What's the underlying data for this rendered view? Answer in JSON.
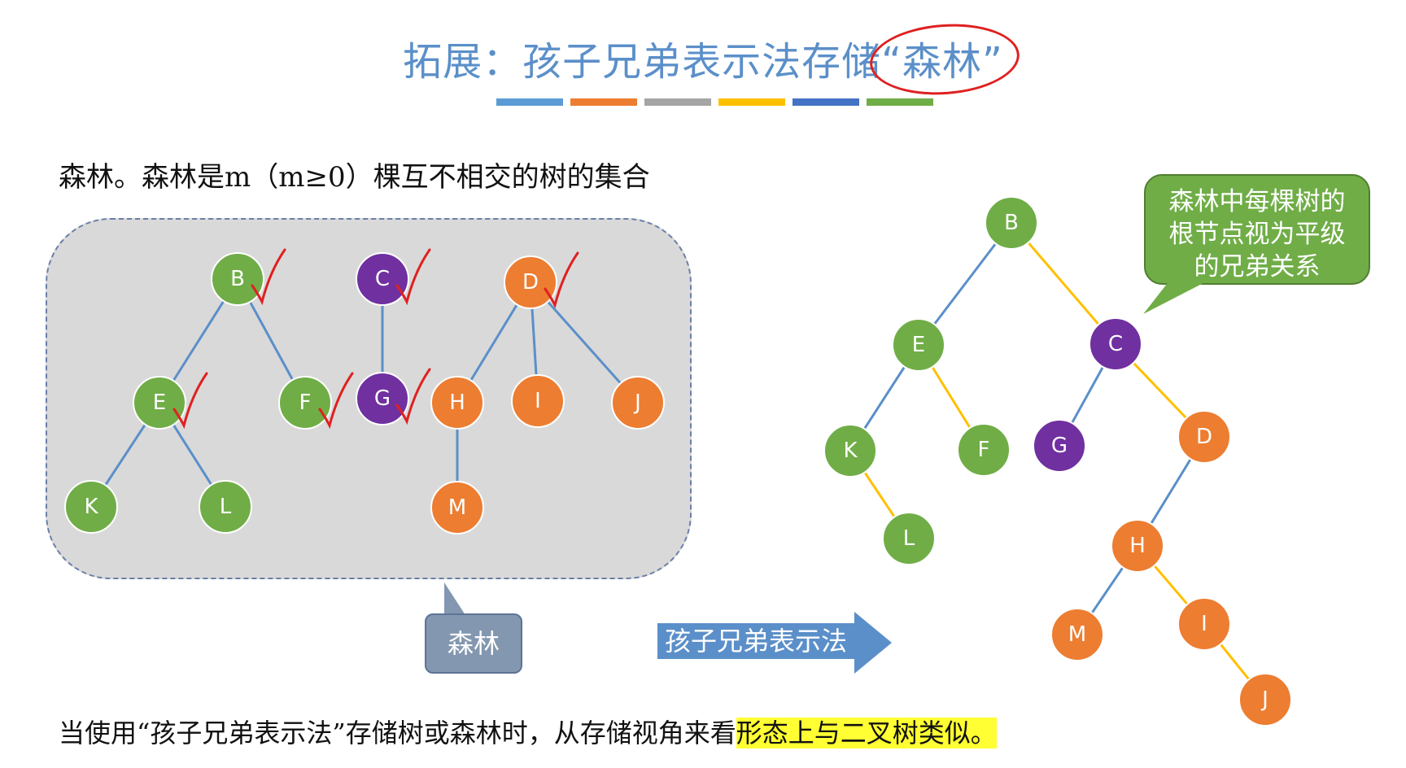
{
  "title": {
    "before": "拓展：孩子兄弟表示法存储",
    "highlight": "“森林”"
  },
  "stripe_colors": [
    "#5b9bd5",
    "#ed7d31",
    "#a5a5a5",
    "#ffc000",
    "#4472c4",
    "#70ad47"
  ],
  "colors": {
    "green": "#70ad47",
    "purple": "#7030a0",
    "orange": "#ed7d31",
    "blue_edge": "#5b8fc9",
    "sibling_edge": "#ffc000",
    "check": "#e02020"
  },
  "intro": "森林。森林是m（m≥0）棵互不相交的树的集合",
  "forest_label": "森林",
  "arrow_label": "孩子兄弟表示法",
  "bubble": {
    "line1": "森林中每棵树的",
    "line2": "根节点视为平级",
    "line3": "的兄弟关系"
  },
  "bottom": {
    "plain": "当使用“孩子兄弟表示法”存储树或森林时，从存储视角来看",
    "highlight": "形态上与二叉树类似。"
  },
  "left_nodes": [
    {
      "id": "B",
      "label": "B",
      "color": "green"
    },
    {
      "id": "E",
      "label": "E",
      "color": "green"
    },
    {
      "id": "F",
      "label": "F",
      "color": "green"
    },
    {
      "id": "K",
      "label": "K",
      "color": "green"
    },
    {
      "id": "L",
      "label": "L",
      "color": "green"
    },
    {
      "id": "C",
      "label": "C",
      "color": "purple"
    },
    {
      "id": "G",
      "label": "G",
      "color": "purple"
    },
    {
      "id": "D",
      "label": "D",
      "color": "orange"
    },
    {
      "id": "H",
      "label": "H",
      "color": "orange"
    },
    {
      "id": "I",
      "label": "I",
      "color": "orange"
    },
    {
      "id": "J",
      "label": "J",
      "color": "orange"
    },
    {
      "id": "M",
      "label": "M",
      "color": "orange"
    }
  ],
  "right_nodes": [
    {
      "id": "B",
      "label": "B",
      "color": "green"
    },
    {
      "id": "E",
      "label": "E",
      "color": "green"
    },
    {
      "id": "C",
      "label": "C",
      "color": "purple"
    },
    {
      "id": "K",
      "label": "K",
      "color": "green"
    },
    {
      "id": "F",
      "label": "F",
      "color": "green"
    },
    {
      "id": "G",
      "label": "G",
      "color": "purple"
    },
    {
      "id": "D",
      "label": "D",
      "color": "orange"
    },
    {
      "id": "L",
      "label": "L",
      "color": "green"
    },
    {
      "id": "H",
      "label": "H",
      "color": "orange"
    },
    {
      "id": "M",
      "label": "M",
      "color": "orange"
    },
    {
      "id": "I",
      "label": "I",
      "color": "orange"
    },
    {
      "id": "J",
      "label": "J",
      "color": "orange"
    }
  ],
  "left_edges": [
    [
      "B",
      "E"
    ],
    [
      "B",
      "F"
    ],
    [
      "E",
      "K"
    ],
    [
      "E",
      "L"
    ],
    [
      "C",
      "G"
    ],
    [
      "D",
      "H"
    ],
    [
      "D",
      "I"
    ],
    [
      "D",
      "J"
    ],
    [
      "H",
      "M"
    ]
  ],
  "right_edges": [
    {
      "from": "B",
      "to": "E",
      "kind": "child"
    },
    {
      "from": "B",
      "to": "C",
      "kind": "sibling"
    },
    {
      "from": "E",
      "to": "K",
      "kind": "child"
    },
    {
      "from": "E",
      "to": "F",
      "kind": "sibling"
    },
    {
      "from": "K",
      "to": "L",
      "kind": "sibling"
    },
    {
      "from": "C",
      "to": "G",
      "kind": "child"
    },
    {
      "from": "C",
      "to": "D",
      "kind": "sibling"
    },
    {
      "from": "D",
      "to": "H",
      "kind": "child"
    },
    {
      "from": "H",
      "to": "M",
      "kind": "child"
    },
    {
      "from": "H",
      "to": "I",
      "kind": "sibling"
    },
    {
      "from": "I",
      "to": "J",
      "kind": "sibling"
    }
  ],
  "checked_nodes": [
    "B",
    "E",
    "F",
    "C",
    "G",
    "D"
  ]
}
